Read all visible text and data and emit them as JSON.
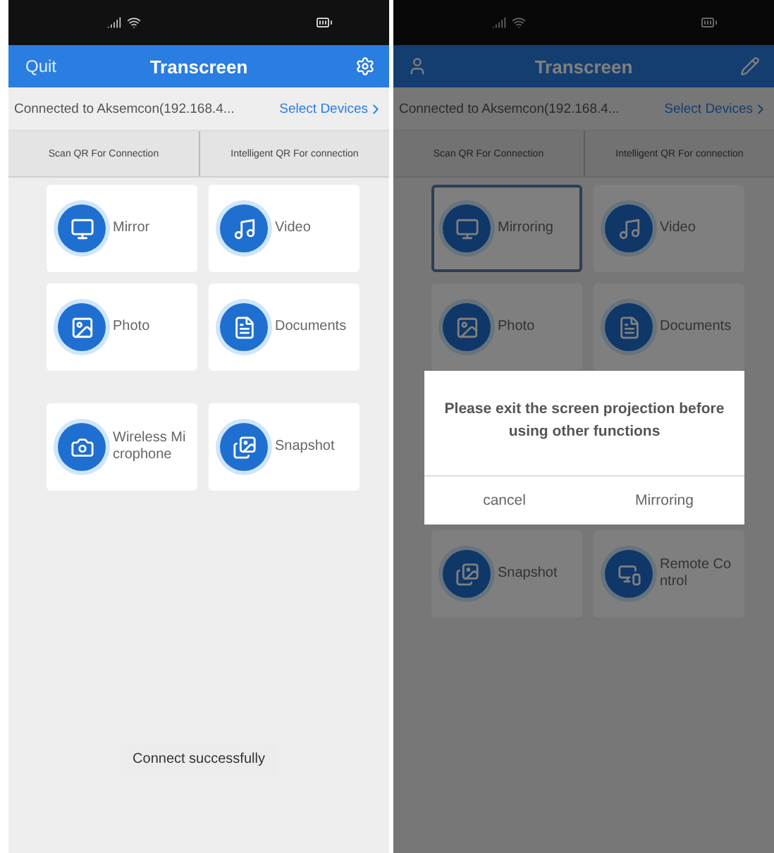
{
  "screens": [
    {
      "dimmed": false,
      "header": {
        "left": "Quit",
        "title": "Transcreen"
      },
      "connection": {
        "text": "Connected to Aksemcon(192.168.4...",
        "action": "Select Devices"
      },
      "tabs": [
        "Scan QR For Connection",
        "Intelligent QR For connection"
      ],
      "groups": [
        [
          {
            "label": "Mirror",
            "kind": "monitor",
            "selected": false
          },
          {
            "label": "Video",
            "kind": "music",
            "selected": false
          },
          {
            "label": "Photo",
            "kind": "image",
            "selected": false
          },
          {
            "label": "Documents",
            "kind": "document",
            "selected": false
          }
        ],
        [
          {
            "label": "Wireless Microphone",
            "kind": "camera",
            "selected": false
          },
          {
            "label": "Snapshot",
            "kind": "gallery",
            "selected": false
          }
        ]
      ],
      "toast": "Connect successfully"
    },
    {
      "dimmed": true,
      "header": {
        "title": "Transcreen"
      },
      "connection": {
        "text": "Connected to Aksemcon(192.168.4...",
        "action": "Select Devices"
      },
      "tabs": [
        "Scan QR For Connection",
        "Intelligent QR For connection"
      ],
      "groups": [
        [
          {
            "label": "Mirroring",
            "kind": "monitor",
            "selected": true
          },
          {
            "label": "Video",
            "kind": "music",
            "selected": false
          },
          {
            "label": "Photo",
            "kind": "image",
            "selected": false
          },
          {
            "label": "Documents",
            "kind": "document",
            "selected": false
          }
        ],
        [
          {
            "label": "Snapshot",
            "kind": "gallery",
            "selected": false
          },
          {
            "label": "Remote Control",
            "kind": "remote",
            "selected": false
          }
        ]
      ],
      "dialog": {
        "message": "Please exit the screen projection before using other functions",
        "buttons": [
          "cancel",
          "Mirroring"
        ]
      }
    }
  ]
}
